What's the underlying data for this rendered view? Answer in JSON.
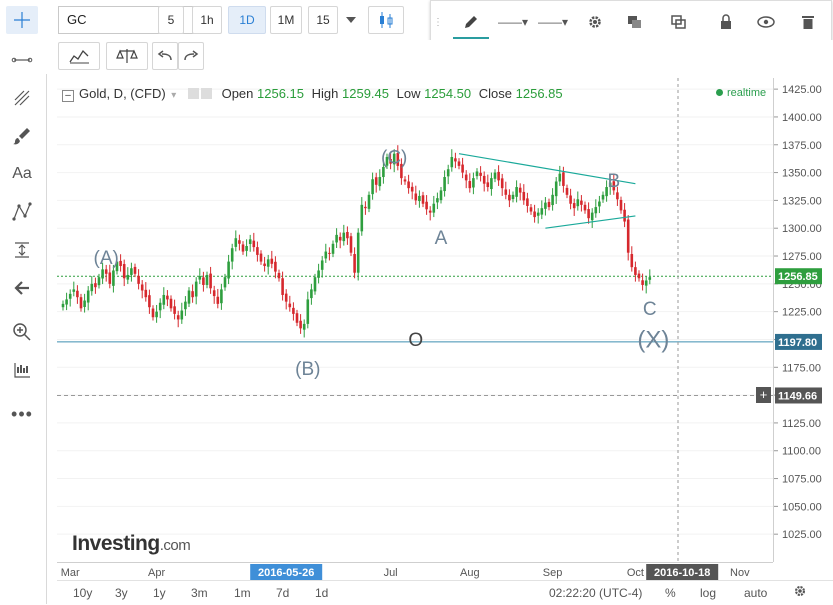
{
  "toolbar": {
    "symbol": "GC",
    "intervals": [
      "5",
      "1h",
      "1D",
      "1M",
      "15"
    ],
    "active_interval": "1D"
  },
  "legend": {
    "title": "Gold, D, (CFD)",
    "open_label": "Open",
    "open": "1256.15",
    "high_label": "High",
    "high": "1259.45",
    "low_label": "Low",
    "low": "1254.50",
    "close_label": "Close",
    "close": "1256.85",
    "realtime": "realtime"
  },
  "logo": {
    "main": "Investing",
    "suffix": ".com"
  },
  "bottom": {
    "ranges": [
      "10y",
      "3y",
      "1y",
      "3m",
      "1m",
      "7d",
      "1d"
    ],
    "time": "02:22:20 (UTC-4)",
    "percent": "%",
    "log": "log",
    "auto": "auto"
  },
  "colors": {
    "up": "#2e9e3e",
    "down": "#d6282d",
    "accent": "#2a7fd4",
    "trendline": "#1aa99a"
  },
  "chart_data": {
    "type": "candlestick",
    "title": "Gold, D, (CFD)",
    "ylim": [
      1000,
      1435
    ],
    "y_ticks": [
      1025,
      1050,
      1075,
      1100,
      1125,
      1150,
      1175,
      1200,
      1225,
      1250,
      1275,
      1300,
      1325,
      1350,
      1375,
      1400,
      1425
    ],
    "x_ticks": [
      "Mar",
      "Apr",
      "2016-05-26",
      "Jul",
      "Aug",
      "Sep",
      "Oct",
      "2016-10-18",
      "Nov"
    ],
    "price_labels": [
      {
        "value": 1256.85,
        "text": "1256.85",
        "color": "#2e9e3e"
      },
      {
        "value": 1197.8,
        "text": "1197.80",
        "color": "#2f6f8f"
      },
      {
        "value": 1149.66,
        "text": "1149.66",
        "color": "#555555"
      }
    ],
    "annotations": [
      {
        "text": "(A)",
        "date_index": 12,
        "value": 1268
      },
      {
        "text": "(B)",
        "date_index": 68,
        "value": 1168
      },
      {
        "text": "(C)",
        "date_index": 92,
        "value": 1358
      },
      {
        "text": "A",
        "date_index": 105,
        "value": 1286
      },
      {
        "text": "B",
        "date_index": 153,
        "value": 1337
      },
      {
        "text": "C",
        "date_index": 163,
        "value": 1222
      },
      {
        "text": "(X)",
        "date_index": 164,
        "value": 1193
      },
      {
        "text": "O",
        "date_index": 98,
        "value": 1194
      }
    ],
    "horizontal_lines": [
      {
        "value": 1256.85,
        "style": "dotted",
        "color": "#2e9e3e"
      },
      {
        "value": 1197.8,
        "style": "solid",
        "color": "#3f8fb0"
      },
      {
        "value": 1149.66,
        "style": "dashed",
        "color": "#999999"
      }
    ],
    "trend_lines": [
      {
        "from": [
          110,
          1367
        ],
        "to": [
          159,
          1340
        ]
      },
      {
        "from": [
          134,
          1300
        ],
        "to": [
          159,
          1311
        ]
      }
    ],
    "candles_close": [
      1232,
      1236,
      1241,
      1245,
      1238,
      1228,
      1235,
      1244,
      1250,
      1247,
      1256,
      1263,
      1259,
      1250,
      1262,
      1270,
      1266,
      1255,
      1258,
      1264,
      1259,
      1250,
      1244,
      1238,
      1229,
      1220,
      1225,
      1233,
      1240,
      1236,
      1228,
      1223,
      1218,
      1226,
      1234,
      1244,
      1238,
      1252,
      1257,
      1249,
      1258,
      1246,
      1239,
      1232,
      1245,
      1256,
      1270,
      1282,
      1291,
      1286,
      1279,
      1284,
      1290,
      1283,
      1276,
      1270,
      1266,
      1272,
      1268,
      1261,
      1255,
      1240,
      1234,
      1229,
      1223,
      1215,
      1210,
      1214,
      1236,
      1245,
      1256,
      1262,
      1271,
      1279,
      1277,
      1286,
      1294,
      1289,
      1296,
      1291,
      1278,
      1260,
      1296,
      1321,
      1318,
      1330,
      1344,
      1339,
      1346,
      1355,
      1364,
      1358,
      1367,
      1356,
      1345,
      1342,
      1336,
      1333,
      1325,
      1329,
      1322,
      1317,
      1314,
      1322,
      1327,
      1334,
      1346,
      1353,
      1364,
      1360,
      1356,
      1350,
      1343,
      1336,
      1345,
      1351,
      1347,
      1340,
      1337,
      1345,
      1350,
      1343,
      1336,
      1330,
      1325,
      1330,
      1337,
      1332,
      1325,
      1320,
      1315,
      1310,
      1314,
      1318,
      1323,
      1319,
      1330,
      1342,
      1349,
      1338,
      1330,
      1322,
      1318,
      1326,
      1321,
      1316,
      1309,
      1314,
      1319,
      1324,
      1330,
      1337,
      1341,
      1334,
      1326,
      1316,
      1306,
      1278,
      1265,
      1258,
      1255,
      1249,
      1253,
      1256
    ]
  }
}
